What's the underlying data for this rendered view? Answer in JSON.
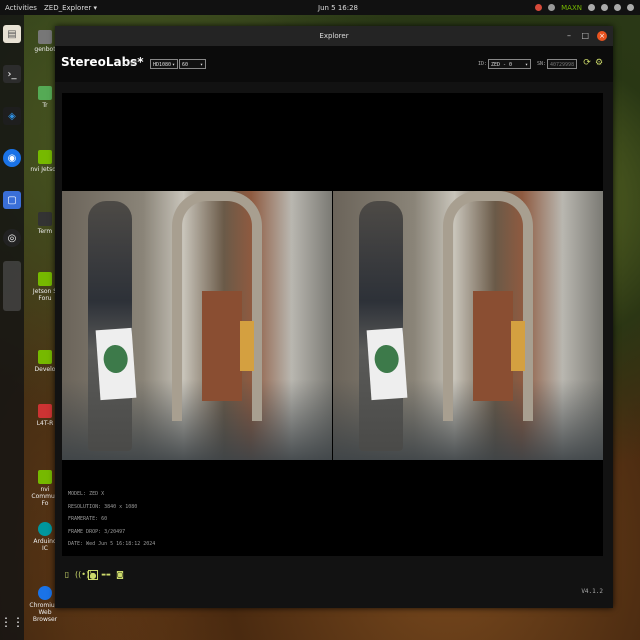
{
  "topbar": {
    "activities": "Activities",
    "app_menu": "ZED_Explorer ▾",
    "clock": "Jun 5 16:28",
    "power_mode": "MAXN"
  },
  "desktop": {
    "items": [
      {
        "label": "genbot"
      },
      {
        "label": "Tr"
      },
      {
        "label": "nvi Jetson"
      },
      {
        "label": "Term"
      },
      {
        "label": "Jetson S Foru"
      },
      {
        "label": "Develo"
      },
      {
        "label": "L4T-R"
      },
      {
        "label": "nvi Commun Fo"
      },
      {
        "label": "Arduino IC"
      },
      {
        "label": "Chromium Web Browser"
      }
    ]
  },
  "window": {
    "title": "Explorer",
    "close_glyph": "×",
    "minimize_glyph": "–",
    "maximize_glyph": "□"
  },
  "toolbar": {
    "brand": "StereoLabs*",
    "live": "LIVE",
    "resolution": "HD1080",
    "fps": "60",
    "id_label": "ID:",
    "id_value": "ZED - 0",
    "sn_label": "SN:",
    "sn_value": "40729998"
  },
  "info": {
    "model": "MODEL: ZED X",
    "resolution": "RESOLUTION: 3840 x 1080",
    "framerate": "FRAMERATE: 60",
    "frame_drop": "FRAME DROP: 3/20497",
    "date": "DATE: Wed Jun 5 16:18:12 2024"
  },
  "footer": {
    "version": "V4.1.2"
  },
  "colors": {
    "accent": "#cbd96a",
    "ubuntu_orange": "#e95420"
  }
}
